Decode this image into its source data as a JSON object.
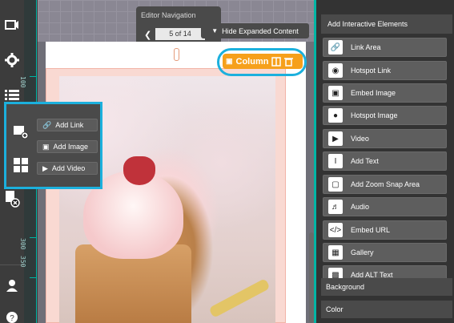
{
  "editor_navigation": {
    "title": "Editor Navigation",
    "page_indicator": "5 of 14",
    "prev_icon": "chevron-left-icon"
  },
  "hide_button": {
    "label": "Hide Expanded Content",
    "icon": "chevron-down-icon"
  },
  "column_badge": {
    "label": "Column",
    "icons": [
      "drag-handle-icon",
      "column-layout-icon",
      "trash-icon"
    ],
    "color": "#f6a01b",
    "highlight_color": "#1cb0dd"
  },
  "add_menu": {
    "items": [
      {
        "label": "Add Link",
        "icon": "link-icon"
      },
      {
        "label": "Add Image",
        "icon": "camera-icon"
      },
      {
        "label": "Add Video",
        "icon": "video-icon"
      }
    ],
    "rail_icons": [
      "image-add-icon",
      "grid-icon"
    ]
  },
  "left_rail": {
    "icons": [
      "presentation-icon",
      "gear-icon",
      "list-icon",
      "image-add-icon",
      "grid-icon",
      "delete-page-icon",
      "user-icon",
      "help-icon"
    ]
  },
  "ruler": {
    "labels": [
      "100",
      "200",
      "300",
      "350"
    ]
  },
  "interactive_panel": {
    "title": "Add Interactive Elements",
    "items": [
      {
        "label": "Link Area",
        "icon": "link-icon"
      },
      {
        "label": "Hotspot Link",
        "icon": "target-icon"
      },
      {
        "label": "Embed Image",
        "icon": "camera-icon"
      },
      {
        "label": "Hotspot Image",
        "icon": "chat-bubble-icon"
      },
      {
        "label": "Video",
        "icon": "video-icon"
      },
      {
        "label": "Add Text",
        "icon": "text-cursor-icon"
      },
      {
        "label": "Add Zoom Snap Area",
        "icon": "zoom-area-icon"
      },
      {
        "label": "Audio",
        "icon": "speaker-icon"
      },
      {
        "label": "Embed URL",
        "icon": "code-icon"
      },
      {
        "label": "Gallery",
        "icon": "gallery-icon"
      },
      {
        "label": "Add ALT Text",
        "icon": "alt-text-icon"
      }
    ]
  },
  "sections": {
    "background": "Background",
    "color": "Color"
  }
}
